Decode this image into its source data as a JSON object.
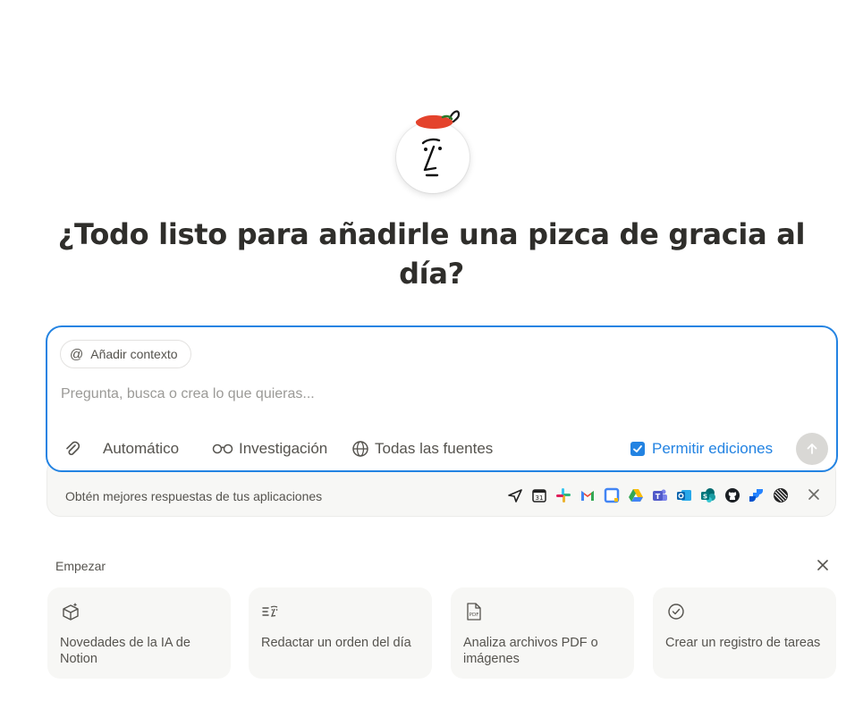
{
  "headline": "¿Todo listo para añadirle una pizca de gracia al día?",
  "composer": {
    "context_button": "Añadir contexto",
    "placeholder": "Pregunta, busca o crea lo que quieras...",
    "mode_label": "Automático",
    "research_label": "Investigación",
    "sources_label": "Todas las fuentes",
    "allow_edits_label": "Permitir ediciones",
    "allow_edits_checked": true
  },
  "apps": {
    "text": "Obtén mejores respuestas de tus aplicaciones",
    "icons": [
      "send-icon",
      "calendar-icon",
      "slack-icon",
      "gmail-icon",
      "outlook-calendar-icon",
      "google-drive-icon",
      "teams-icon",
      "outlook-icon",
      "sharepoint-icon",
      "github-icon",
      "jira-icon",
      "linear-icon"
    ]
  },
  "start": {
    "label": "Empezar",
    "cards": [
      {
        "icon": "cube-sparkle-icon",
        "label": "Novedades de la IA de Notion"
      },
      {
        "icon": "list-face-icon",
        "label": "Redactar un orden del día"
      },
      {
        "icon": "pdf-icon",
        "label": "Analiza archivos PDF o imágenes"
      },
      {
        "icon": "check-circle-icon",
        "label": "Crear un registro de tareas"
      }
    ]
  },
  "colors": {
    "accent": "#2383e2",
    "pepper": "#e4432c",
    "card_bg": "#f7f7f5"
  }
}
